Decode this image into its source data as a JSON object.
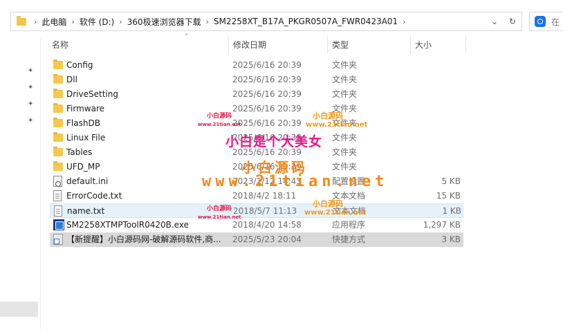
{
  "address": {
    "breadcrumbs": [
      "此电脑",
      "软件 (D:)",
      "360极速浏览器下载",
      "SM2258XT_B17A_PKGR0507A_FWR0423A01"
    ],
    "refresh_icon": "refresh-icon",
    "dropdown_icon": "chevron-down-icon"
  },
  "search": {
    "placeholder": "在"
  },
  "columns": {
    "name": "名称",
    "date": "修改日期",
    "type": "类型",
    "size": "大小"
  },
  "files": [
    {
      "name": "Config",
      "date": "2025/6/16 20:39",
      "type": "文件夹",
      "size": "",
      "icon": "folder-icon"
    },
    {
      "name": "Dll",
      "date": "2025/6/16 20:39",
      "type": "文件夹",
      "size": "",
      "icon": "folder-icon"
    },
    {
      "name": "DriveSetting",
      "date": "2025/6/16 20:39",
      "type": "文件夹",
      "size": "",
      "icon": "folder-icon"
    },
    {
      "name": "Firmware",
      "date": "2025/6/16 20:39",
      "type": "文件夹",
      "size": "",
      "icon": "folder-icon"
    },
    {
      "name": "FlashDB",
      "date": "2025/6/16 20:39",
      "type": "文件夹",
      "size": "",
      "icon": "folder-icon"
    },
    {
      "name": "Linux File",
      "date": "2025/6/16 20:39",
      "type": "文件夹",
      "size": "",
      "icon": "folder-icon"
    },
    {
      "name": "Tables",
      "date": "2025/6/16 20:39",
      "type": "文件夹",
      "size": "",
      "icon": "folder-icon"
    },
    {
      "name": "UFD_MP",
      "date": "2025/6/16 20:39",
      "type": "文件夹",
      "size": "",
      "icon": "folder-icon"
    },
    {
      "name": "default.ini",
      "date": "2023/1/12 14:43",
      "type": "配置设置",
      "size": "5 KB",
      "icon": "settings-file-icon"
    },
    {
      "name": "ErrorCode.txt",
      "date": "2018/4/2 18:11",
      "type": "文本文档",
      "size": "15 KB",
      "icon": "text-file-icon"
    },
    {
      "name": "name.txt",
      "date": "2018/5/7 11:13",
      "type": "文本文档",
      "size": "1 KB",
      "icon": "text-file-icon"
    },
    {
      "name": "SM2258XTMPToolR0420B.exe",
      "date": "2018/4/20 14:58",
      "type": "应用程序",
      "size": "1,297 KB",
      "icon": "application-icon"
    },
    {
      "name": "【新提醒】小白源码网-破解源码软件,商...",
      "date": "2025/5/23 20:04",
      "type": "快捷方式",
      "size": "3 KB",
      "icon": "shortcut-icon"
    }
  ],
  "watermarks": {
    "small_cn": "小白源码",
    "small_url": "www.21tian.net",
    "orange_cn": "小白源码",
    "orange_url": "www.21tian.net",
    "big_pink": "小白是个大美女",
    "big_orange": "小白源码",
    "huge_url": "www.21tian.net"
  }
}
